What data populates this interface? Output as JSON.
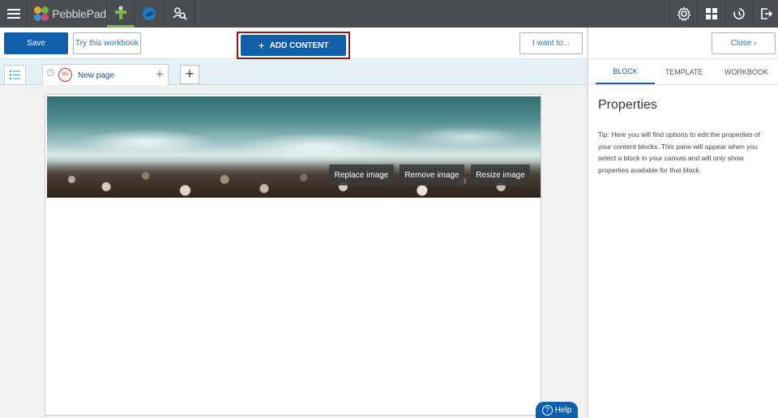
{
  "topbar": {
    "logo_text": "PebblePad",
    "logo_colors": [
      "#e8a33a",
      "#6db33f",
      "#3a8fd0",
      "#c84f7a"
    ],
    "icons": [
      "menu-icon",
      "create-icon",
      "asset-store-icon",
      "atlas-icon",
      "settings-icon",
      "apps-grid-icon",
      "history-icon",
      "logout-icon"
    ],
    "active_accent": "#7ab648"
  },
  "toolbar": {
    "save_label": "Save",
    "try_label": "Try this workbook",
    "add_content_label": "ADD CONTENT",
    "i_want_label": "I want to..."
  },
  "tabs": {
    "page_badge": "Ws",
    "page_name": "New page"
  },
  "image_actions": {
    "replace": "Replace image",
    "remove": "Remove image",
    "resize": "Resize image"
  },
  "panel": {
    "close_label": "Close",
    "tabs": [
      "BLOCK",
      "TEMPLATE",
      "WORKBOOK"
    ],
    "title": "Properties",
    "tip": "Tip: Here you will find options to edit the properties of your content blocks. This pane will appear when you select a block in your canvas and will only show properties available for that block."
  },
  "help": {
    "label": "Help"
  },
  "colors": {
    "primary": "#0f5faa",
    "topbar": "#4a4d52",
    "highlight_border": "#8b1a1a"
  }
}
